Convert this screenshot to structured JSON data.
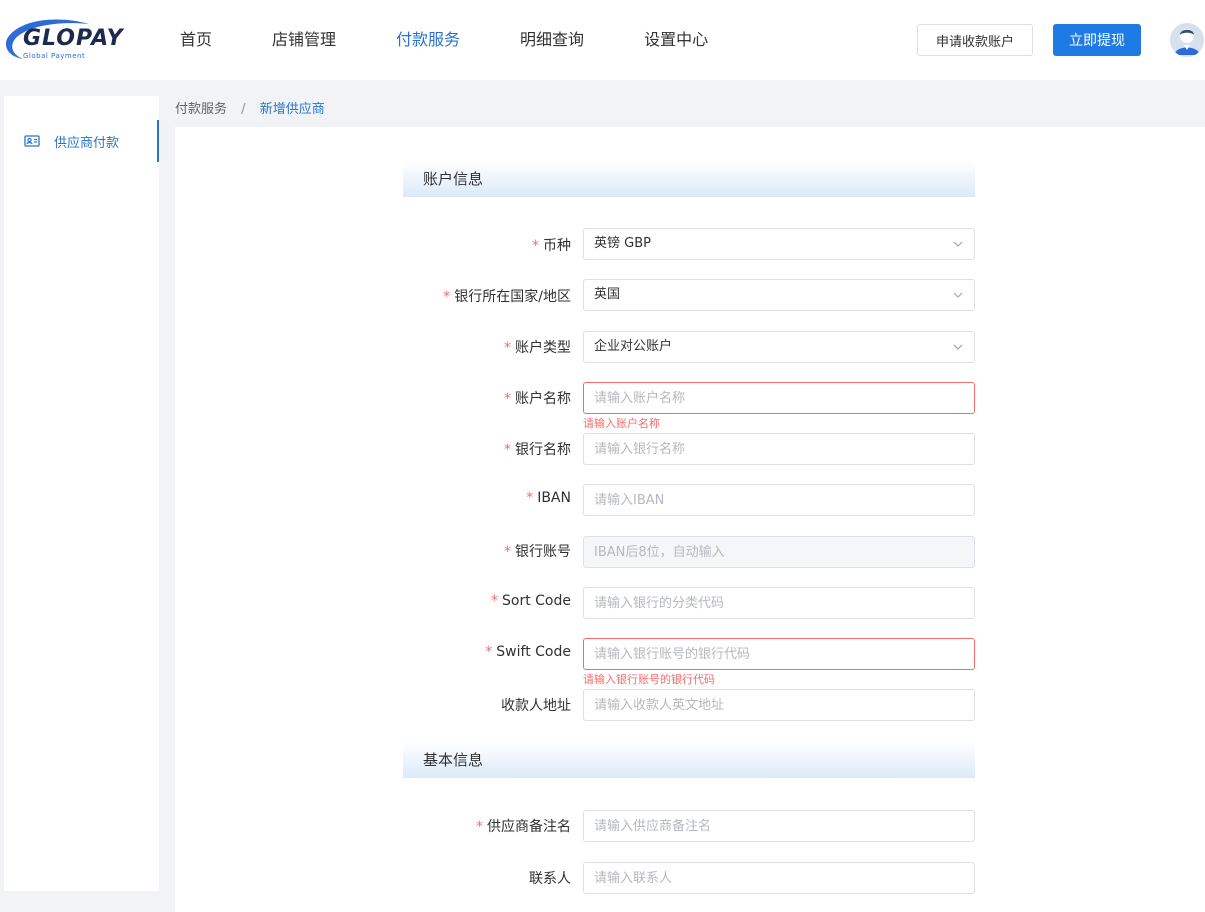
{
  "header": {
    "logo_text": "GLOPAY",
    "logo_sub": "Global Payment",
    "nav": [
      {
        "label": "首页"
      },
      {
        "label": "店铺管理"
      },
      {
        "label": "付款服务"
      },
      {
        "label": "明细查询"
      },
      {
        "label": "设置中心"
      }
    ],
    "active_nav": "付款服务",
    "apply_button": "申请收款账户",
    "withdraw_button": "立即提现"
  },
  "sidebar": {
    "items": [
      {
        "label": "供应商付款",
        "icon": "id-card-icon"
      }
    ]
  },
  "breadcrumb": {
    "parent": "付款服务",
    "separator": "/",
    "current": "新增供应商"
  },
  "form": {
    "required_mark": "*",
    "account_section": "账户信息",
    "basic_section": "基本信息",
    "currency": {
      "label": "币种",
      "value": "英镑 GBP"
    },
    "bank_country": {
      "label": "银行所在国家/地区",
      "value": "英国"
    },
    "account_type": {
      "label": "账户类型",
      "value": "企业对公账户"
    },
    "account_name": {
      "label": "账户名称",
      "placeholder": "请输入账户名称",
      "error": "请输入账户名称"
    },
    "bank_name": {
      "label": "银行名称",
      "placeholder": "请输入银行名称"
    },
    "iban": {
      "label": "IBAN",
      "placeholder": "请输入IBAN"
    },
    "bank_account": {
      "label": "银行账号",
      "placeholder": "IBAN后8位，自动输入"
    },
    "sort_code": {
      "label": "Sort Code",
      "placeholder": "请输入银行的分类代码"
    },
    "swift_code": {
      "label": "Swift Code",
      "placeholder": "请输入银行账号的银行代码",
      "error": "请输入银行账号的银行代码"
    },
    "payee_address": {
      "label": "收款人地址",
      "placeholder": "请输入收款人英文地址"
    },
    "supplier_remark": {
      "label": "供应商备注名",
      "placeholder": "请输入供应商备注名"
    },
    "contact": {
      "label": "联系人",
      "placeholder": "请输入联系人"
    }
  },
  "colors": {
    "primary": "#1e7be6",
    "active_text": "#2a74c9",
    "error": "#f56c6c"
  }
}
